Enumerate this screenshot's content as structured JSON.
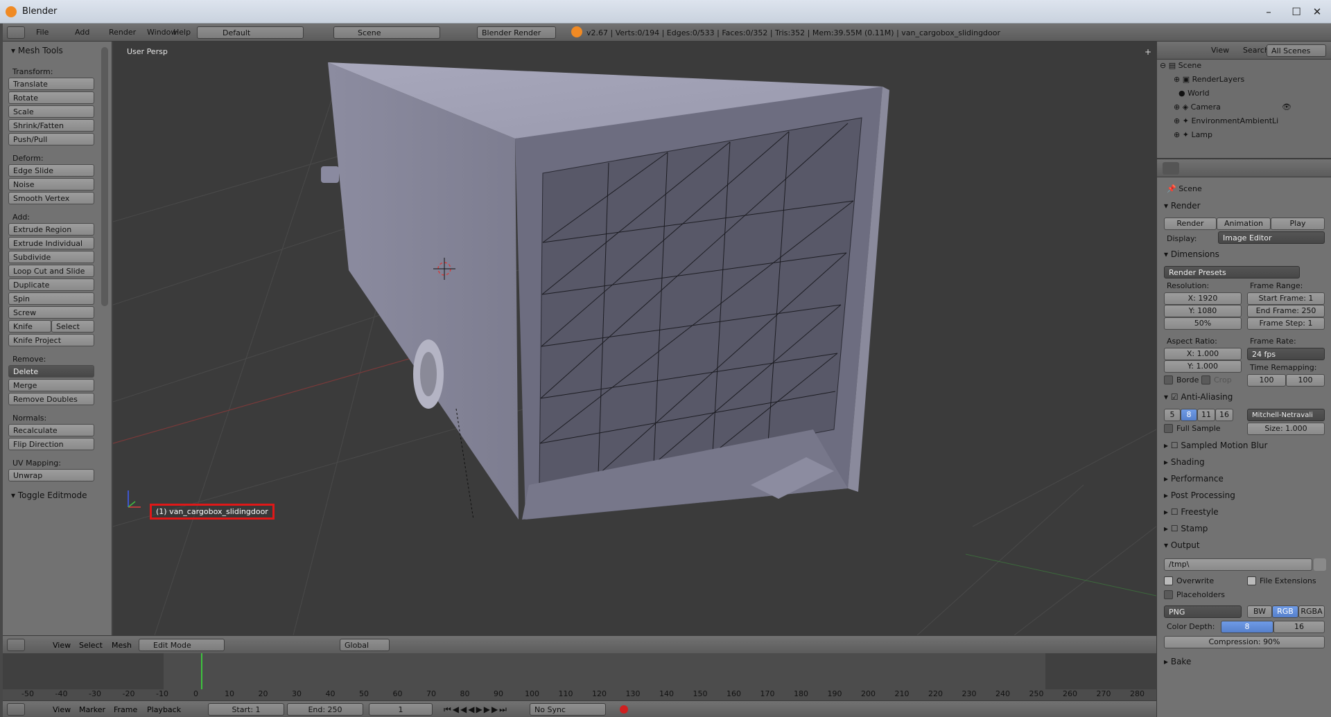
{
  "window": {
    "title": "Blender"
  },
  "info_header": {
    "menus": [
      "File",
      "Add",
      "Render",
      "Window",
      "Help"
    ],
    "layout": "Default",
    "scene": "Scene",
    "engine": "Blender Render",
    "stats": "v2.67 | Verts:0/194 | Edges:0/533 | Faces:0/352 | Tris:352 | Mem:39.55M (0.11M) | van_cargobox_slidingdoor"
  },
  "toolshelf": {
    "panel_title": "Mesh Tools",
    "sections": {
      "transform": {
        "label": "Transform:",
        "buttons": [
          "Translate",
          "Rotate",
          "Scale",
          "Shrink/Fatten",
          "Push/Pull"
        ]
      },
      "deform": {
        "label": "Deform:",
        "buttons": [
          "Edge Slide",
          "Noise",
          "Smooth Vertex"
        ]
      },
      "add": {
        "label": "Add:",
        "buttons": [
          "Extrude Region",
          "Extrude Individual",
          "Subdivide",
          "Loop Cut and Slide",
          "Duplicate",
          "Spin",
          "Screw"
        ],
        "knife": "Knife",
        "select": "Select",
        "knife_project": "Knife Project"
      },
      "remove": {
        "label": "Remove:",
        "delete": "Delete",
        "buttons": [
          "Merge",
          "Remove Doubles"
        ]
      },
      "normals": {
        "label": "Normals:",
        "buttons": [
          "Recalculate",
          "Flip Direction"
        ]
      },
      "uv": {
        "label": "UV Mapping:",
        "buttons": [
          "Unwrap"
        ]
      }
    },
    "toggle_editmode": "Toggle Editmode"
  },
  "viewport": {
    "view_name": "User Persp",
    "object_label": "(1) van_cargobox_slidingdoor"
  },
  "view3d_header": {
    "menus": [
      "View",
      "Select",
      "Mesh"
    ],
    "mode": "Edit Mode",
    "orientation": "Global"
  },
  "timeline": {
    "ticks": [
      "-50",
      "-40",
      "-30",
      "-20",
      "-10",
      "0",
      "10",
      "20",
      "30",
      "40",
      "50",
      "60",
      "70",
      "80",
      "90",
      "100",
      "110",
      "120",
      "130",
      "140",
      "150",
      "160",
      "170",
      "180",
      "190",
      "200",
      "210",
      "220",
      "230",
      "240",
      "250",
      "260",
      "270",
      "280"
    ],
    "menus": [
      "View",
      "Marker",
      "Frame",
      "Playback"
    ],
    "start": "Start: 1",
    "end": "End: 250",
    "current": "1",
    "sync": "No Sync"
  },
  "outliner": {
    "menus": [
      "View",
      "Search"
    ],
    "filter": "All Scenes",
    "items": [
      "Scene",
      "RenderLayers",
      "World",
      "Camera",
      "EnvironmentAmbientLi",
      "Lamp"
    ]
  },
  "properties": {
    "context": "Scene",
    "render": {
      "title": "Render",
      "render_btn": "Render",
      "animation_btn": "Animation",
      "play_btn": "Play",
      "display_label": "Display:",
      "display_value": "Image Editor"
    },
    "dimensions": {
      "title": "Dimensions",
      "presets": "Render Presets",
      "resolution_label": "Resolution:",
      "res_x": "X: 1920",
      "res_y": "Y: 1080",
      "res_pct": "50%",
      "frame_range_label": "Frame Range:",
      "start_frame": "Start Frame: 1",
      "end_frame": "End Frame: 250",
      "frame_step": "Frame Step: 1",
      "aspect_label": "Aspect Ratio:",
      "aspect_x": "X: 1.000",
      "aspect_y": "Y: 1.000",
      "frame_rate_label": "Frame Rate:",
      "frame_rate": "24 fps",
      "time_remap_label": "Time Remapping:",
      "remap_old": "100",
      "remap_new": "100",
      "border": "Borde",
      "crop": "Crop"
    },
    "antialiasing": {
      "title": "Anti-Aliasing",
      "samples": [
        "5",
        "8",
        "11",
        "16"
      ],
      "filter": "Mitchell-Netravali",
      "full_sample": "Full Sample",
      "size": "Size: 1.000"
    },
    "collapsed": [
      "Sampled Motion Blur",
      "Shading",
      "Performance",
      "Post Processing",
      "Freestyle",
      "Stamp"
    ],
    "output": {
      "title": "Output",
      "path": "/tmp\\",
      "overwrite": "Overwrite",
      "file_extensions": "File Extensions",
      "placeholders": "Placeholders",
      "format": "PNG",
      "color_modes": [
        "BW",
        "RGB",
        "RGBA"
      ],
      "color_depth_label": "Color Depth:",
      "depths": [
        "8",
        "16"
      ],
      "compression": "Compression: 90%"
    },
    "bake": "Bake"
  },
  "colors": {
    "selected_blue": "#5680cc",
    "timeline_cursor": "#3ec43e",
    "highlight_red": "#e01818"
  }
}
